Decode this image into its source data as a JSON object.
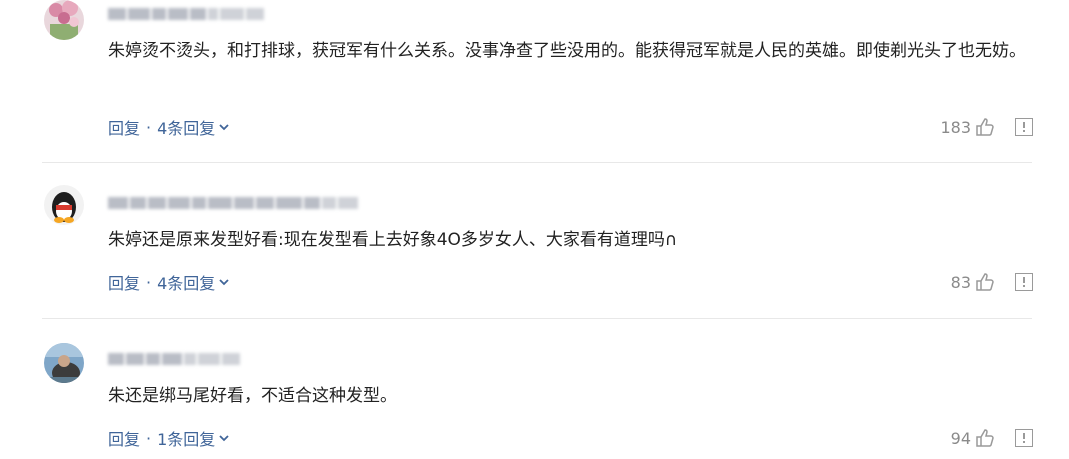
{
  "comments": [
    {
      "text": "朱婷烫不烫头，和打排球，获冠军有什么关系。没事净查了些没用的。能获得冠军就是人民的英雄。即使剃光头了也无妨。",
      "reply_label": "回复",
      "replies_label": "4条回复",
      "likes": "183"
    },
    {
      "text": "朱婷还是原来发型好看:现在发型看上去好象4O多岁女人、大家看有道理吗∩",
      "reply_label": "回复",
      "replies_label": "4条回复",
      "likes": "83"
    },
    {
      "text": "朱还是绑马尾好看，不适合这种发型。",
      "reply_label": "回复",
      "replies_label": "1条回复",
      "likes": "94"
    }
  ],
  "separator": "·",
  "icons": {
    "like": "thumbs-up-icon",
    "report": "report-icon",
    "expand": "chevron-down-icon"
  },
  "colors": {
    "link": "#406599",
    "count": "#8a8a8a",
    "text": "#222222",
    "divider": "#e8e8e8"
  }
}
